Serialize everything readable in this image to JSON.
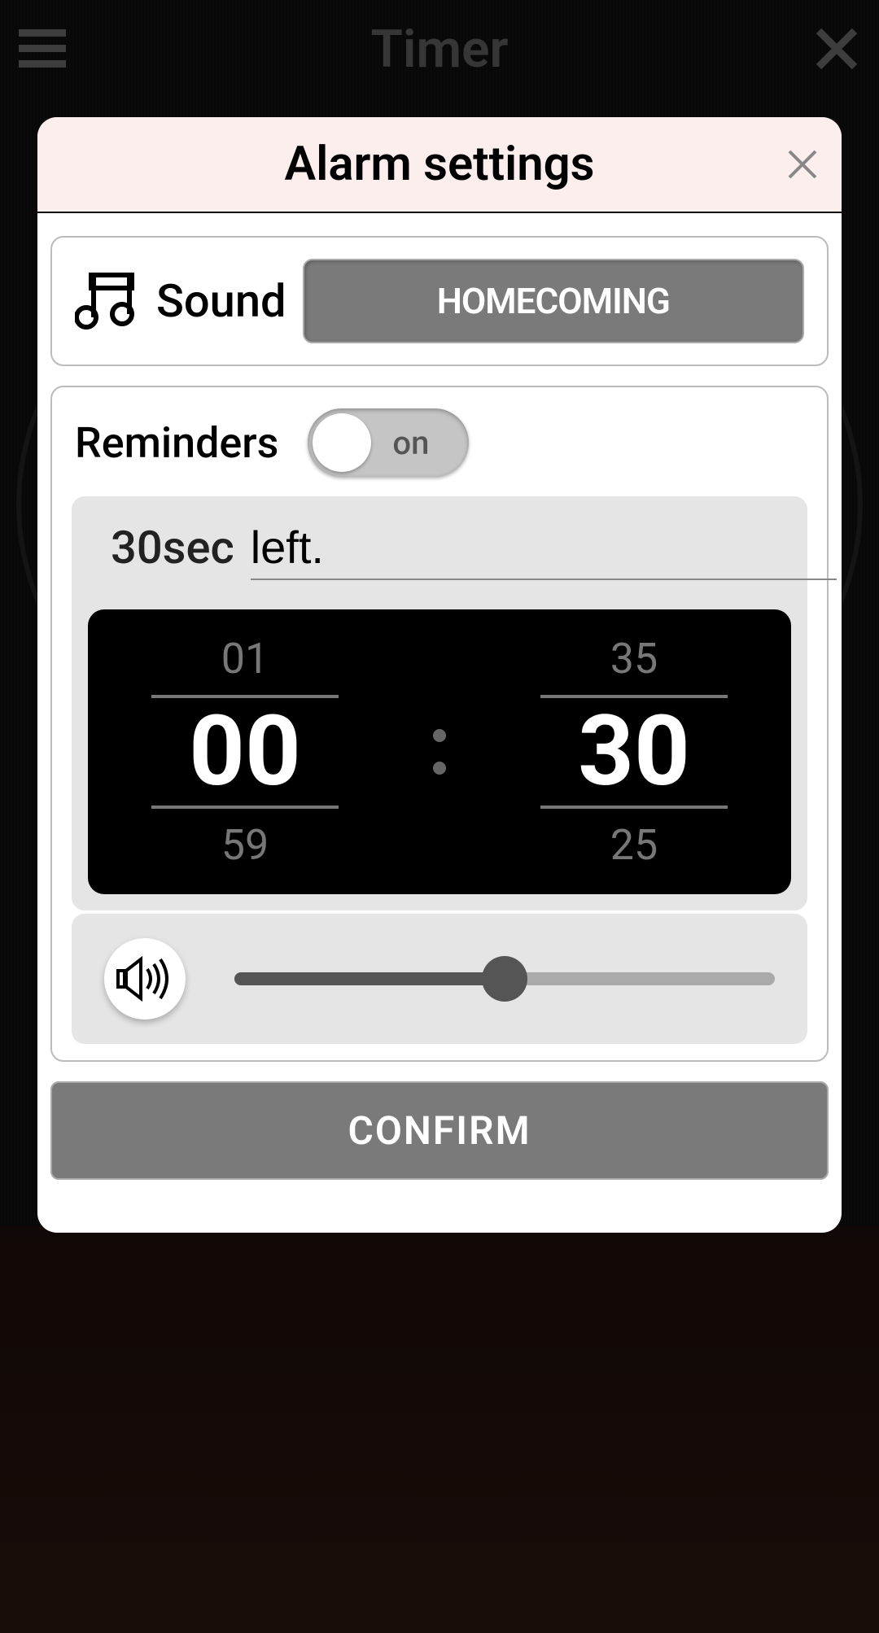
{
  "page": {
    "title": "Timer"
  },
  "modal": {
    "title": "Alarm settings",
    "sound": {
      "label": "Sound",
      "value": "HOMECOMING"
    },
    "reminders": {
      "label": "Reminders",
      "toggle_text": "on",
      "toggle_state": true,
      "summary_time": "30sec",
      "summary_input": "left.",
      "picker": {
        "min_above": "01",
        "min": "00",
        "min_below": "59",
        "sec_above": "35",
        "sec": "30",
        "sec_below": "25"
      }
    },
    "volume": {
      "percent": 50
    },
    "confirm_label": "CONFIRM"
  }
}
